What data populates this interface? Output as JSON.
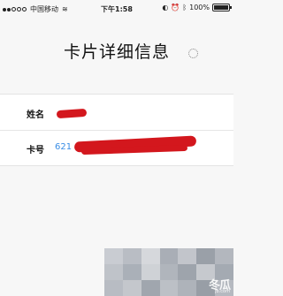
{
  "status_bar": {
    "carrier": "中国移动",
    "wifi_icon": "wifi-icon",
    "time": "下午1:58",
    "battery_text": "100%",
    "battery_level": 1.0
  },
  "page": {
    "title": "卡片详细信息"
  },
  "card_details": {
    "name_label": "姓名",
    "card_number_label": "卡号",
    "card_number_prefix": "621"
  },
  "watermark": {
    "brand": "冬瓜",
    "sub": "jb.com"
  }
}
